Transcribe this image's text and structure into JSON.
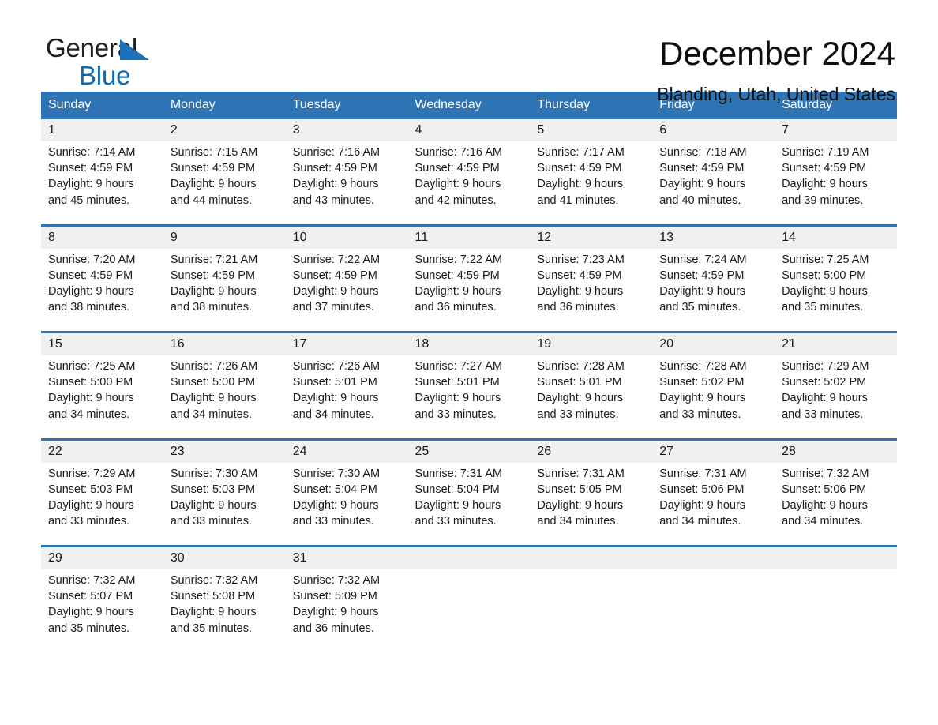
{
  "brand": {
    "name_top": "General",
    "name_bottom": "Blue",
    "color_black": "#231f20",
    "color_blue": "#1169b0"
  },
  "header": {
    "title": "December 2024",
    "location": "Blanding, Utah, United States"
  },
  "theme": {
    "header_blue": "#2e73b4",
    "daynum_bg": "#f0f0f0",
    "text": "#1a1a1a"
  },
  "calendar": {
    "weekday_headers": [
      "Sunday",
      "Monday",
      "Tuesday",
      "Wednesday",
      "Thursday",
      "Friday",
      "Saturday"
    ],
    "weeks": [
      [
        {
          "day": "1",
          "sunrise": "Sunrise: 7:14 AM",
          "sunset": "Sunset: 4:59 PM",
          "daylight1": "Daylight: 9 hours",
          "daylight2": "and 45 minutes."
        },
        {
          "day": "2",
          "sunrise": "Sunrise: 7:15 AM",
          "sunset": "Sunset: 4:59 PM",
          "daylight1": "Daylight: 9 hours",
          "daylight2": "and 44 minutes."
        },
        {
          "day": "3",
          "sunrise": "Sunrise: 7:16 AM",
          "sunset": "Sunset: 4:59 PM",
          "daylight1": "Daylight: 9 hours",
          "daylight2": "and 43 minutes."
        },
        {
          "day": "4",
          "sunrise": "Sunrise: 7:16 AM",
          "sunset": "Sunset: 4:59 PM",
          "daylight1": "Daylight: 9 hours",
          "daylight2": "and 42 minutes."
        },
        {
          "day": "5",
          "sunrise": "Sunrise: 7:17 AM",
          "sunset": "Sunset: 4:59 PM",
          "daylight1": "Daylight: 9 hours",
          "daylight2": "and 41 minutes."
        },
        {
          "day": "6",
          "sunrise": "Sunrise: 7:18 AM",
          "sunset": "Sunset: 4:59 PM",
          "daylight1": "Daylight: 9 hours",
          "daylight2": "and 40 minutes."
        },
        {
          "day": "7",
          "sunrise": "Sunrise: 7:19 AM",
          "sunset": "Sunset: 4:59 PM",
          "daylight1": "Daylight: 9 hours",
          "daylight2": "and 39 minutes."
        }
      ],
      [
        {
          "day": "8",
          "sunrise": "Sunrise: 7:20 AM",
          "sunset": "Sunset: 4:59 PM",
          "daylight1": "Daylight: 9 hours",
          "daylight2": "and 38 minutes."
        },
        {
          "day": "9",
          "sunrise": "Sunrise: 7:21 AM",
          "sunset": "Sunset: 4:59 PM",
          "daylight1": "Daylight: 9 hours",
          "daylight2": "and 38 minutes."
        },
        {
          "day": "10",
          "sunrise": "Sunrise: 7:22 AM",
          "sunset": "Sunset: 4:59 PM",
          "daylight1": "Daylight: 9 hours",
          "daylight2": "and 37 minutes."
        },
        {
          "day": "11",
          "sunrise": "Sunrise: 7:22 AM",
          "sunset": "Sunset: 4:59 PM",
          "daylight1": "Daylight: 9 hours",
          "daylight2": "and 36 minutes."
        },
        {
          "day": "12",
          "sunrise": "Sunrise: 7:23 AM",
          "sunset": "Sunset: 4:59 PM",
          "daylight1": "Daylight: 9 hours",
          "daylight2": "and 36 minutes."
        },
        {
          "day": "13",
          "sunrise": "Sunrise: 7:24 AM",
          "sunset": "Sunset: 4:59 PM",
          "daylight1": "Daylight: 9 hours",
          "daylight2": "and 35 minutes."
        },
        {
          "day": "14",
          "sunrise": "Sunrise: 7:25 AM",
          "sunset": "Sunset: 5:00 PM",
          "daylight1": "Daylight: 9 hours",
          "daylight2": "and 35 minutes."
        }
      ],
      [
        {
          "day": "15",
          "sunrise": "Sunrise: 7:25 AM",
          "sunset": "Sunset: 5:00 PM",
          "daylight1": "Daylight: 9 hours",
          "daylight2": "and 34 minutes."
        },
        {
          "day": "16",
          "sunrise": "Sunrise: 7:26 AM",
          "sunset": "Sunset: 5:00 PM",
          "daylight1": "Daylight: 9 hours",
          "daylight2": "and 34 minutes."
        },
        {
          "day": "17",
          "sunrise": "Sunrise: 7:26 AM",
          "sunset": "Sunset: 5:01 PM",
          "daylight1": "Daylight: 9 hours",
          "daylight2": "and 34 minutes."
        },
        {
          "day": "18",
          "sunrise": "Sunrise: 7:27 AM",
          "sunset": "Sunset: 5:01 PM",
          "daylight1": "Daylight: 9 hours",
          "daylight2": "and 33 minutes."
        },
        {
          "day": "19",
          "sunrise": "Sunrise: 7:28 AM",
          "sunset": "Sunset: 5:01 PM",
          "daylight1": "Daylight: 9 hours",
          "daylight2": "and 33 minutes."
        },
        {
          "day": "20",
          "sunrise": "Sunrise: 7:28 AM",
          "sunset": "Sunset: 5:02 PM",
          "daylight1": "Daylight: 9 hours",
          "daylight2": "and 33 minutes."
        },
        {
          "day": "21",
          "sunrise": "Sunrise: 7:29 AM",
          "sunset": "Sunset: 5:02 PM",
          "daylight1": "Daylight: 9 hours",
          "daylight2": "and 33 minutes."
        }
      ],
      [
        {
          "day": "22",
          "sunrise": "Sunrise: 7:29 AM",
          "sunset": "Sunset: 5:03 PM",
          "daylight1": "Daylight: 9 hours",
          "daylight2": "and 33 minutes."
        },
        {
          "day": "23",
          "sunrise": "Sunrise: 7:30 AM",
          "sunset": "Sunset: 5:03 PM",
          "daylight1": "Daylight: 9 hours",
          "daylight2": "and 33 minutes."
        },
        {
          "day": "24",
          "sunrise": "Sunrise: 7:30 AM",
          "sunset": "Sunset: 5:04 PM",
          "daylight1": "Daylight: 9 hours",
          "daylight2": "and 33 minutes."
        },
        {
          "day": "25",
          "sunrise": "Sunrise: 7:31 AM",
          "sunset": "Sunset: 5:04 PM",
          "daylight1": "Daylight: 9 hours",
          "daylight2": "and 33 minutes."
        },
        {
          "day": "26",
          "sunrise": "Sunrise: 7:31 AM",
          "sunset": "Sunset: 5:05 PM",
          "daylight1": "Daylight: 9 hours",
          "daylight2": "and 34 minutes."
        },
        {
          "day": "27",
          "sunrise": "Sunrise: 7:31 AM",
          "sunset": "Sunset: 5:06 PM",
          "daylight1": "Daylight: 9 hours",
          "daylight2": "and 34 minutes."
        },
        {
          "day": "28",
          "sunrise": "Sunrise: 7:32 AM",
          "sunset": "Sunset: 5:06 PM",
          "daylight1": "Daylight: 9 hours",
          "daylight2": "and 34 minutes."
        }
      ],
      [
        {
          "day": "29",
          "sunrise": "Sunrise: 7:32 AM",
          "sunset": "Sunset: 5:07 PM",
          "daylight1": "Daylight: 9 hours",
          "daylight2": "and 35 minutes."
        },
        {
          "day": "30",
          "sunrise": "Sunrise: 7:32 AM",
          "sunset": "Sunset: 5:08 PM",
          "daylight1": "Daylight: 9 hours",
          "daylight2": "and 35 minutes."
        },
        {
          "day": "31",
          "sunrise": "Sunrise: 7:32 AM",
          "sunset": "Sunset: 5:09 PM",
          "daylight1": "Daylight: 9 hours",
          "daylight2": "and 36 minutes."
        },
        {
          "day": "",
          "sunrise": "",
          "sunset": "",
          "daylight1": "",
          "daylight2": ""
        },
        {
          "day": "",
          "sunrise": "",
          "sunset": "",
          "daylight1": "",
          "daylight2": ""
        },
        {
          "day": "",
          "sunrise": "",
          "sunset": "",
          "daylight1": "",
          "daylight2": ""
        },
        {
          "day": "",
          "sunrise": "",
          "sunset": "",
          "daylight1": "",
          "daylight2": ""
        }
      ]
    ]
  }
}
